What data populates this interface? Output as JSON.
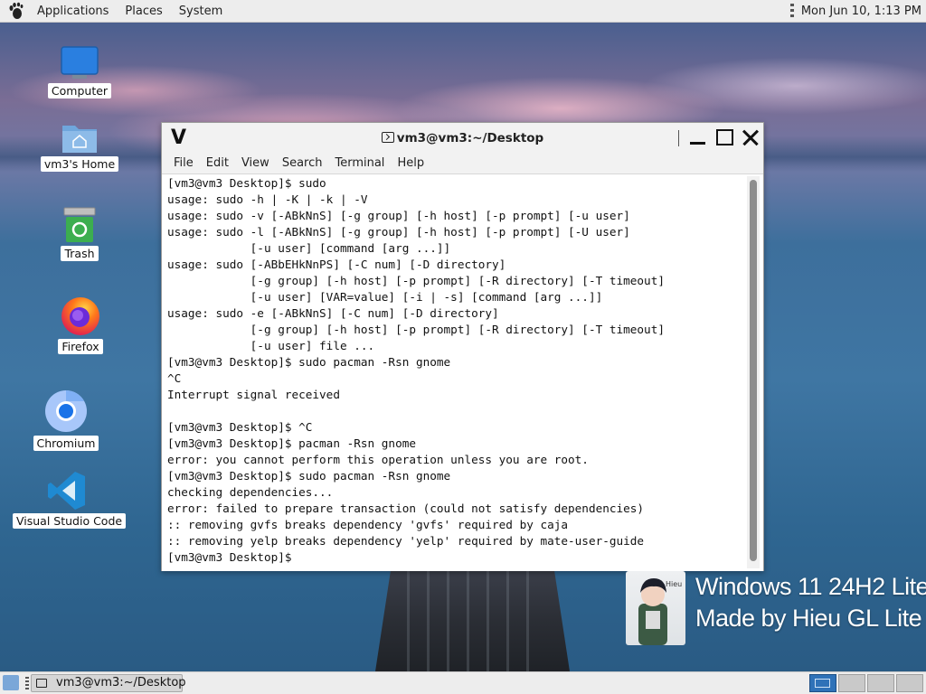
{
  "top_panel": {
    "menus": [
      "Applications",
      "Places",
      "System"
    ],
    "clock": "Mon Jun 10,  1:13 PM"
  },
  "desktop_icons": [
    {
      "label": "Computer",
      "icon": "computer-icon"
    },
    {
      "label": "vm3's Home",
      "icon": "home-folder-icon"
    },
    {
      "label": "Trash",
      "icon": "trash-icon"
    },
    {
      "label": "Firefox",
      "icon": "firefox-icon"
    },
    {
      "label": "Chromium",
      "icon": "chromium-icon"
    },
    {
      "label": "Visual Studio Code",
      "icon": "vscode-icon"
    }
  ],
  "terminal": {
    "app_icon_glyph": "V",
    "title": "vm3@vm3:~/Desktop",
    "menu": [
      "File",
      "Edit",
      "View",
      "Search",
      "Terminal",
      "Help"
    ],
    "lines": [
      "[vm3@vm3 Desktop]$ sudo",
      "usage: sudo -h | -K | -k | -V",
      "usage: sudo -v [-ABkNnS] [-g group] [-h host] [-p prompt] [-u user]",
      "usage: sudo -l [-ABkNnS] [-g group] [-h host] [-p prompt] [-U user]",
      "            [-u user] [command [arg ...]]",
      "usage: sudo [-ABbEHkNnPS] [-C num] [-D directory]",
      "            [-g group] [-h host] [-p prompt] [-R directory] [-T timeout]",
      "            [-u user] [VAR=value] [-i | -s] [command [arg ...]]",
      "usage: sudo -e [-ABkNnS] [-C num] [-D directory]",
      "            [-g group] [-h host] [-p prompt] [-R directory] [-T timeout]",
      "            [-u user] file ...",
      "[vm3@vm3 Desktop]$ sudo pacman -Rsn gnome",
      "^C",
      "Interrupt signal received",
      "",
      "[vm3@vm3 Desktop]$ ^C",
      "[vm3@vm3 Desktop]$ pacman -Rsn gnome",
      "error: you cannot perform this operation unless you are root.",
      "[vm3@vm3 Desktop]$ sudo pacman -Rsn gnome",
      "checking dependencies...",
      "error: failed to prepare transaction (could not satisfy dependencies)",
      ":: removing gvfs breaks dependency 'gvfs' required by caja",
      ":: removing yelp breaks dependency 'yelp' required by mate-user-guide",
      "[vm3@vm3 Desktop]$ "
    ]
  },
  "watermark": {
    "line1": "Windows 11 24H2 Lite",
    "line2": "Made by Hieu GL Lite",
    "avatar_caption": "Hieu"
  },
  "bottom_panel": {
    "task_label": "vm3@vm3:~/Desktop",
    "workspaces": 4,
    "active_workspace": 1
  }
}
